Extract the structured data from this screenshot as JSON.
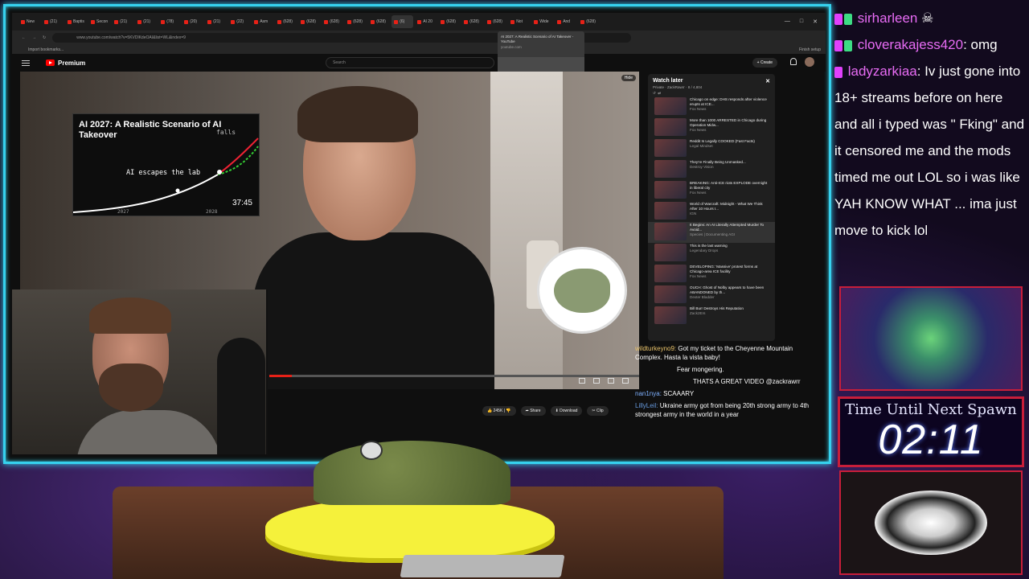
{
  "browser": {
    "tabs": [
      "New",
      "(21)",
      "Baptis",
      "Secon",
      "(21)",
      "(21)",
      "(78)",
      "(20)",
      "(21)",
      "(22)",
      "Asm",
      "(628)",
      "(628)",
      "(628)",
      "(628)",
      "(628)",
      "(6)",
      "AI 20",
      "(628)",
      "(628)",
      "(628)",
      "Not",
      "Wide",
      "And",
      "(628)",
      "(628)",
      "(628)"
    ],
    "url": "www.youtube.com/watch?v=5KVDlKdeOAI&list=WL&index=9",
    "bookmarks_label": "Import bookmarks...",
    "finish_setup": "Finish setup",
    "tooltip_title": "AI 2027: A Realistic Scenario of AI Takeover - YouTube",
    "tooltip_domain": "youtube.com"
  },
  "youtube": {
    "logo_text": "Premium",
    "search_placeholder": "Search",
    "create_label": "Create",
    "hide_label": "Hide",
    "actions": {
      "like": "245K",
      "share": "Share",
      "download": "Download",
      "clip": "Clip"
    },
    "progress_fraction": 0.06
  },
  "overlay_video": {
    "title": "AI 2027: A Realistic Scenario of AI Takeover",
    "falls": "falls",
    "annotation": "AI escapes the lab",
    "duration": "37:45",
    "year_start": "2027",
    "year_end": "2028"
  },
  "watch_later": {
    "title": "Watch later",
    "subtitle": "Private · ZackRawrr · 8 / 4,804",
    "items": [
      {
        "title": "Chicago on edge: DHS responds after violence erupts at ICE...",
        "channel": "Fox News"
      },
      {
        "title": "More than 1000 ARRESTED in Chicago during Operation Midw...",
        "channel": "Fox News"
      },
      {
        "title": "Reddit Is Legally COOKED (Fast Facts)",
        "channel": "Legal Mindset"
      },
      {
        "title": "They're Finally Being Unmasked...",
        "channel": "Destroy Vision"
      },
      {
        "title": "BREAKING: Anti-ICE riots EXPLODE overnight in liberal city",
        "channel": "Fox News"
      },
      {
        "title": "World of Warcraft: Midnight - What We Think After 10 Hours I...",
        "channel": "IGN"
      },
      {
        "title": "It Begins: An AI Literally Attempted Murder To Avoid...",
        "channel": "Species | Documenting AGI"
      },
      {
        "title": "This is the last warning",
        "channel": "Legendary Drops"
      },
      {
        "title": "DEVELOPING: 'Massive' protest forms at Chicago-area ICE facility",
        "channel": "Fox News"
      },
      {
        "title": "OUCH: Ghost of Nolby appears to have been ABANDONED by th...",
        "channel": "Dexter Bladder"
      },
      {
        "title": "Bill Burr Destroys His Reputation",
        "channel": "Zack2Ers"
      }
    ]
  },
  "stream_chat_overlay": [
    {
      "user": "wildturkeyno9:",
      "text": "Got my ticket to the Cheyenne Mountain Complex. Hasta la vista baby!"
    },
    {
      "user": "",
      "text": "Fear mongering."
    },
    {
      "user": "",
      "text": "THATS A GREAT VIDEO @zackrawrr"
    },
    {
      "user": "nan1nya:",
      "text": "SCAAARY"
    },
    {
      "user": "LillyLeil:",
      "text": "Ukraine army got from being 20th strong army to 4th strongest army in the world in a year"
    }
  ],
  "side_chat": [
    {
      "user": "sirharleen",
      "text": ""
    },
    {
      "user": "cloverakajess420",
      "text": ": omg"
    },
    {
      "user": "ladyzarkiaa",
      "text": ": Iv just gone into 18+ streams before on here and all i typed was \" Fking\" and it censored me and the mods timed me out LOL so i was like YAH KNOW WHAT ... ima just move to kick lol"
    }
  ],
  "timer": {
    "label": "Time Until Next Spawn",
    "value": "02:11"
  },
  "colors": {
    "frame_accent": "#36d1ee",
    "panel_border": "#c81e3a",
    "youtube_red": "#ff0000",
    "username_pink": "#e86cf5"
  }
}
